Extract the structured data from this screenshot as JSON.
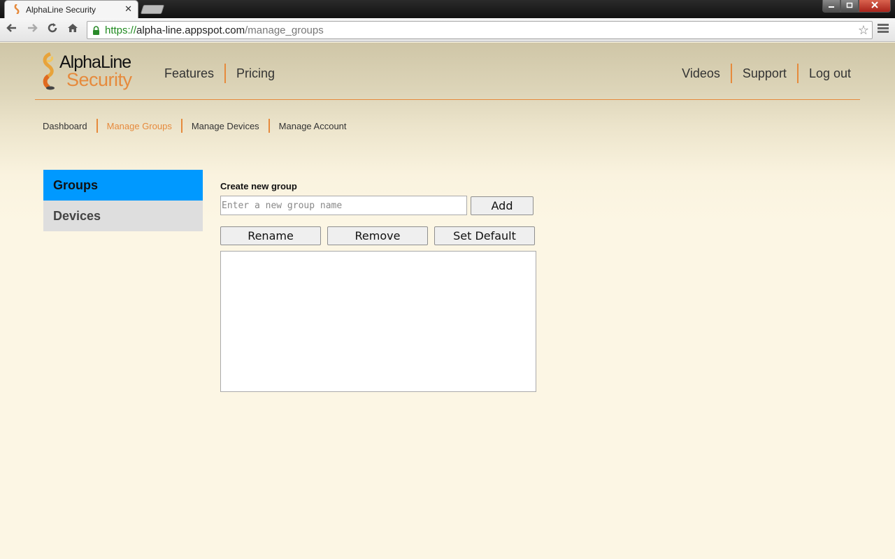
{
  "browser": {
    "tab_title": "AlphaLine Security",
    "tab_close": "✕",
    "url_scheme": "https://",
    "url_host": "alpha-line.appspot.com",
    "url_path": "/manage_groups",
    "icons": [
      "back-icon",
      "forward-icon",
      "reload-icon",
      "home-icon",
      "lock-icon",
      "star-icon",
      "menu-icon"
    ]
  },
  "logo": {
    "top": "AlphaLine",
    "bottom": "Security"
  },
  "nav": {
    "left": [
      "Features",
      "Pricing"
    ],
    "right": [
      "Videos",
      "Support",
      "Log out"
    ]
  },
  "subnav": {
    "items": [
      "Dashboard",
      "Manage Groups",
      "Manage Devices",
      "Manage Account"
    ],
    "active": "Manage Groups"
  },
  "sidebar": {
    "items": [
      "Groups",
      "Devices"
    ],
    "active": "Groups"
  },
  "content": {
    "create_label": "Create new group",
    "input_placeholder": "Enter a new group name",
    "input_value": "",
    "add_label": "Add",
    "rename_label": "Rename",
    "remove_label": "Remove",
    "default_label": "Set Default",
    "groups": []
  },
  "colors": {
    "accent": "#e68a3c",
    "active_sidebar": "#0099ff",
    "inactive_sidebar": "#dedede",
    "page_bg": "#fcf6e4"
  }
}
